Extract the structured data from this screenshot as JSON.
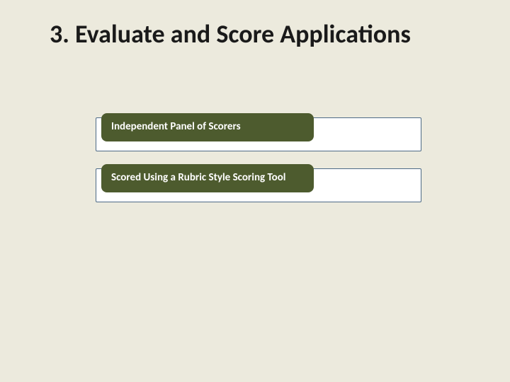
{
  "title": "3. Evaluate and Score Applications",
  "items": [
    {
      "label": "Independent Panel of Scorers"
    },
    {
      "label": "Scored Using a Rubric Style Scoring Tool"
    }
  ],
  "colors": {
    "background": "#eceadd",
    "pill": "#4d5b2e",
    "row_border": "#4d6a86",
    "row_fill": "#ffffff"
  }
}
